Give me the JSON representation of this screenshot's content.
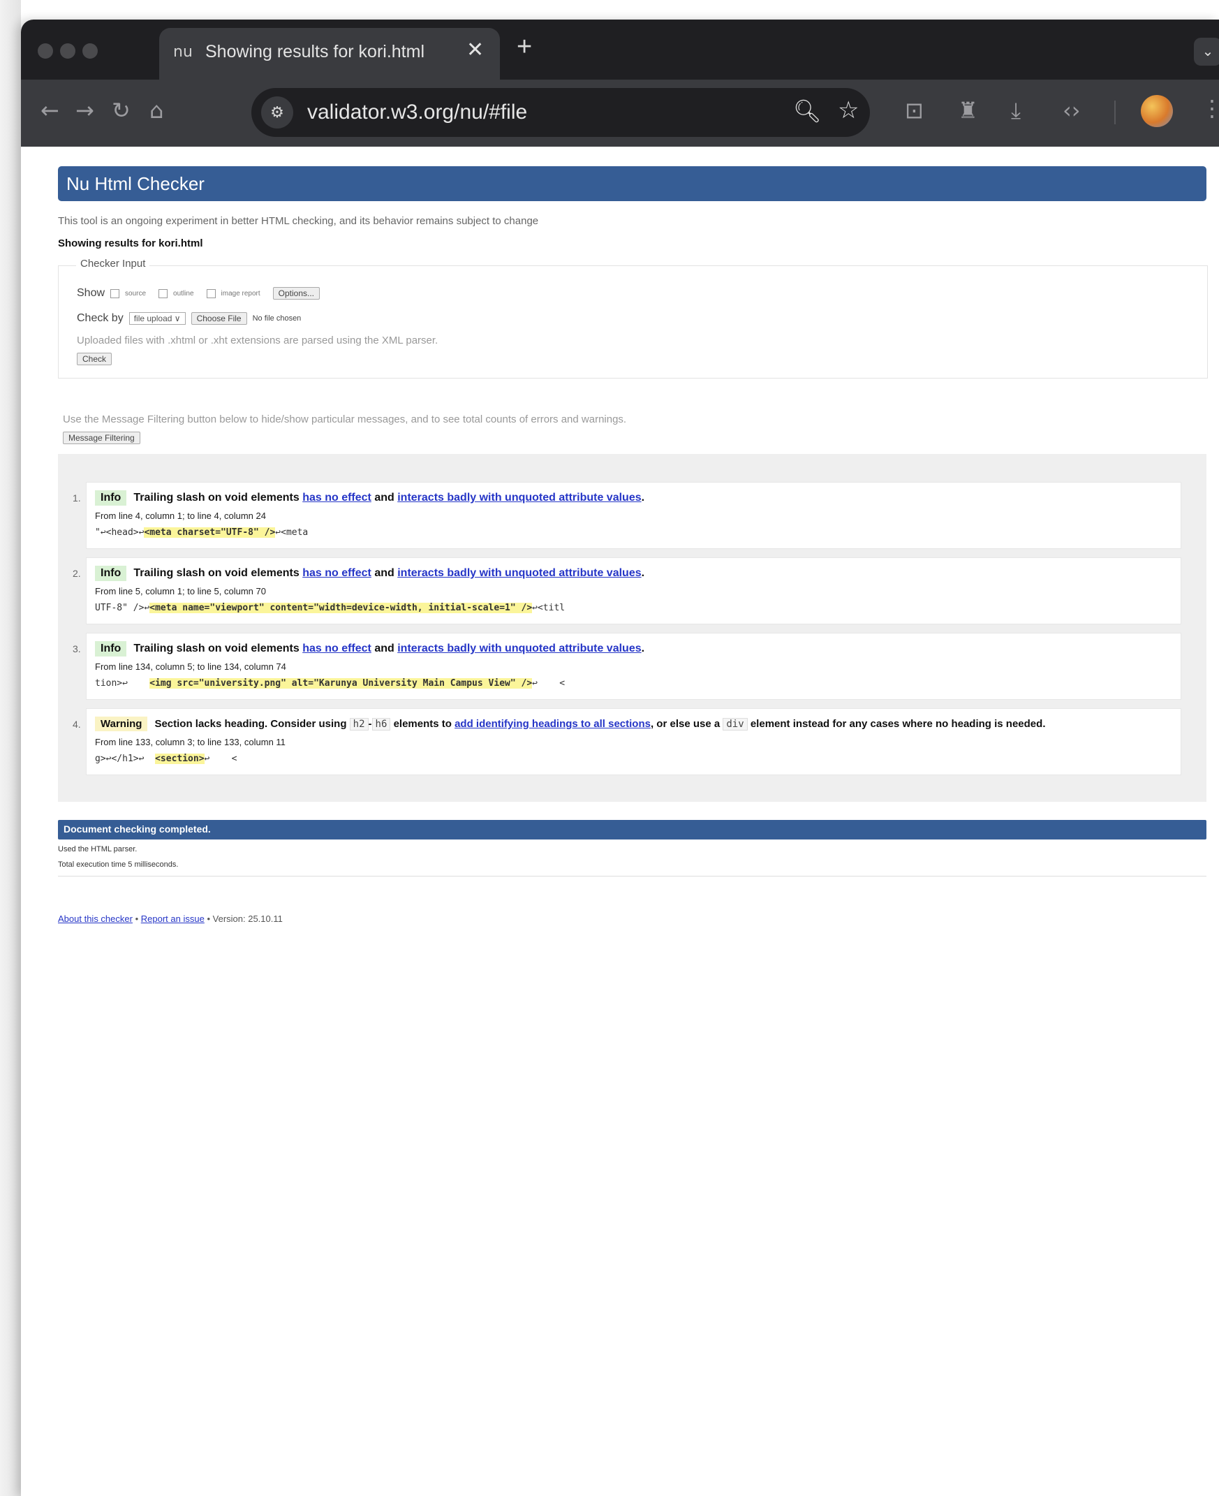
{
  "browser": {
    "tab_title": "Showing results for kori.html",
    "tab_favicon": "nu",
    "url": "validator.w3.org/nu/#file",
    "icons": [
      "back-arrow-icon",
      "forward-arrow-icon",
      "reload-icon",
      "home-icon",
      "site-settings-icon",
      "zoom-icon",
      "bookmark-star-icon",
      "screen-capture-icon",
      "extension-icon",
      "download-icon",
      "devtools-icon",
      "profile-avatar-icon",
      "kebab-menu-icon"
    ]
  },
  "page": {
    "banner_title": "Nu Html Checker",
    "intro": "This tool is an ongoing experiment in better HTML checking, and its behavior remains subject to change",
    "showing": "Showing results for kori.html",
    "checker_input": {
      "legend": "Checker Input",
      "show_label": "Show",
      "show_options": [
        "source",
        "outline",
        "image report"
      ],
      "options_button": "Options...",
      "check_by_label": "Check by",
      "check_by_value": "file upload",
      "choose_file_button": "Choose File",
      "no_file": "No file chosen",
      "xml_note": "Uploaded files with .xhtml or .xht extensions are parsed using the XML parser.",
      "check_button": "Check"
    },
    "filter_note": "Use the Message Filtering button below to hide/show particular messages, and to see total counts of errors and warnings.",
    "filter_button": "Message Filtering",
    "messages": [
      {
        "num": "1.",
        "type": "Info",
        "text": "Trailing slash on void elements",
        "link1": "has no effect",
        "and": "and",
        "link2": "interacts badly with unquoted attribute values",
        "period": ".",
        "location": "From line 4, column 1; to line 4, column 24",
        "ext_before": "\"↩<head>↩",
        "ext_hl": "<meta charset=\"UTF-8\" />",
        "ext_after": "↩<meta"
      },
      {
        "num": "2.",
        "type": "Info",
        "text": "Trailing slash on void elements",
        "link1": "has no effect",
        "and": "and",
        "link2": "interacts badly with unquoted attribute values",
        "period": ".",
        "location": "From line 5, column 1; to line 5, column 70",
        "ext_before": "UTF-8\" />↩",
        "ext_hl": "<meta name=\"viewport\" content=\"width=device-width, initial-scale=1\" />",
        "ext_after": "↩<titl"
      },
      {
        "num": "3.",
        "type": "Info",
        "text": "Trailing slash on void elements",
        "link1": "has no effect",
        "and": "and",
        "link2": "interacts badly with unquoted attribute values",
        "period": ".",
        "location": "From line 134, column 5; to line 134, column 74",
        "ext_before": "tion>↩    ",
        "ext_hl": "<img src=\"university.png\" alt=\"Karunya University Main Campus View\" />",
        "ext_after": "↩    <"
      },
      {
        "num": "4.",
        "type": "Warning",
        "text_a": "Section lacks heading. Consider using",
        "code1": "h2",
        "dash": "-",
        "code2": "h6",
        "text_b": "elements to",
        "link1": "add identifying headings to all sections",
        "text_c": ", or else use a",
        "code3": "div",
        "text_d": "element instead for any cases where no heading is needed.",
        "location": "From line 133, column 3; to line 133, column 11",
        "ext_before": "g>↩</h1>↩  ",
        "ext_hl": "<section>",
        "ext_after": "↩    <"
      }
    ],
    "done": "Document checking completed.",
    "used_parser": "Used the HTML parser.",
    "exec_time": "Total execution time 5 milliseconds.",
    "footer": {
      "about": "About this checker",
      "sep": "•",
      "report": "Report an issue",
      "version": "Version: 25.10.11"
    }
  }
}
